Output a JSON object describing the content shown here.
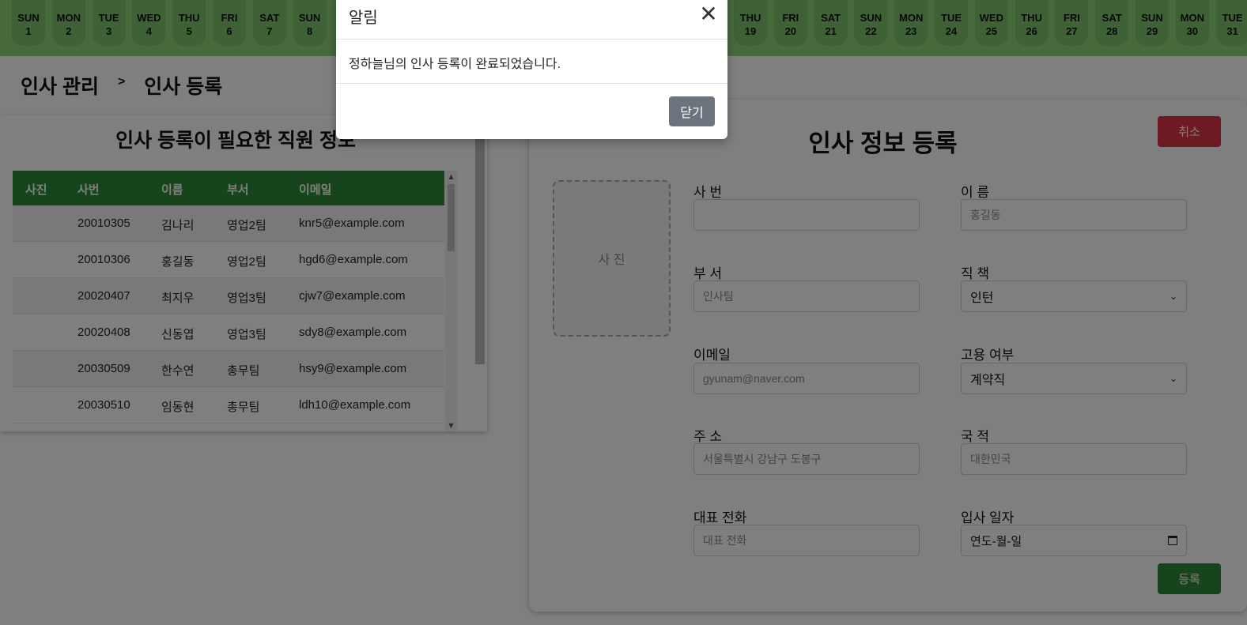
{
  "calendar": {
    "days_left": [
      {
        "dow": "SUN",
        "num": "1"
      },
      {
        "dow": "MON",
        "num": "2"
      },
      {
        "dow": "TUE",
        "num": "3"
      },
      {
        "dow": "WED",
        "num": "4"
      },
      {
        "dow": "THU",
        "num": "5"
      },
      {
        "dow": "FRI",
        "num": "6"
      },
      {
        "dow": "SAT",
        "num": "7"
      },
      {
        "dow": "SUN",
        "num": "8"
      }
    ],
    "days_right": [
      {
        "dow": "THU",
        "num": "19"
      },
      {
        "dow": "FRI",
        "num": "20"
      },
      {
        "dow": "SAT",
        "num": "21"
      },
      {
        "dow": "SUN",
        "num": "22"
      },
      {
        "dow": "MON",
        "num": "23"
      },
      {
        "dow": "TUE",
        "num": "24"
      },
      {
        "dow": "WED",
        "num": "25"
      },
      {
        "dow": "THU",
        "num": "26"
      },
      {
        "dow": "FRI",
        "num": "27"
      },
      {
        "dow": "SAT",
        "num": "28"
      },
      {
        "dow": "SUN",
        "num": "29"
      },
      {
        "dow": "MON",
        "num": "30"
      },
      {
        "dow": "TUE",
        "num": "31"
      }
    ]
  },
  "breadcrumb": {
    "parent": "인사 관리",
    "separator": ">",
    "current": "인사 등록"
  },
  "employee_list": {
    "title": "인사 등록이 필요한 직원 정보",
    "columns": [
      "사진",
      "사번",
      "이름",
      "부서",
      "이메일"
    ],
    "rows": [
      {
        "photo": "",
        "id": "20010305",
        "name": "김나리",
        "dept": "영업2팀",
        "email": "knr5@example.com"
      },
      {
        "photo": "",
        "id": "20010306",
        "name": "홍길동",
        "dept": "영업2팀",
        "email": "hgd6@example.com"
      },
      {
        "photo": "",
        "id": "20020407",
        "name": "최지우",
        "dept": "영업3팀",
        "email": "cjw7@example.com"
      },
      {
        "photo": "",
        "id": "20020408",
        "name": "신동엽",
        "dept": "영업3팀",
        "email": "sdy8@example.com"
      },
      {
        "photo": "",
        "id": "20030509",
        "name": "한수연",
        "dept": "총무팀",
        "email": "hsy9@example.com"
      },
      {
        "photo": "",
        "id": "20030510",
        "name": "임동현",
        "dept": "총무팀",
        "email": "ldh10@example.com"
      }
    ]
  },
  "form": {
    "title": "인사 정보 등록",
    "cancel_label": "취소",
    "photo_label": "사 진",
    "emp_id": {
      "label": "사 번",
      "value": "",
      "placeholder": ""
    },
    "name": {
      "label": "이 름",
      "value": "",
      "placeholder": "홍길동"
    },
    "dept": {
      "label": "부 서",
      "value": "",
      "placeholder": "인사팀"
    },
    "position": {
      "label": "직 책",
      "value": "인턴"
    },
    "email": {
      "label": "이메일",
      "value": "",
      "placeholder": "gyunam@naver.com"
    },
    "employment": {
      "label": "고용 여부",
      "value": "계약직"
    },
    "address": {
      "label": "주 소",
      "value": "",
      "placeholder": "서울특별시 강남구 도봉구"
    },
    "nationality": {
      "label": "국 적",
      "value": "",
      "placeholder": "대한민국"
    },
    "phone": {
      "label": "대표 전화",
      "value": "",
      "placeholder": "대표 전화"
    },
    "hire_date": {
      "label": "입사 일자",
      "value": "연도-월-일"
    },
    "submit_label": "등록"
  },
  "modal": {
    "title": "알림",
    "message": "정하늘님의 인사 등록이 완료되었습니다.",
    "close_label": "닫기"
  },
  "colors": {
    "calendar_bg": "#8fd47a",
    "table_header": "#2e8b36",
    "cancel_button": "#dc3545",
    "submit_button": "#2e8b36",
    "modal_close_button": "#6c757d"
  }
}
